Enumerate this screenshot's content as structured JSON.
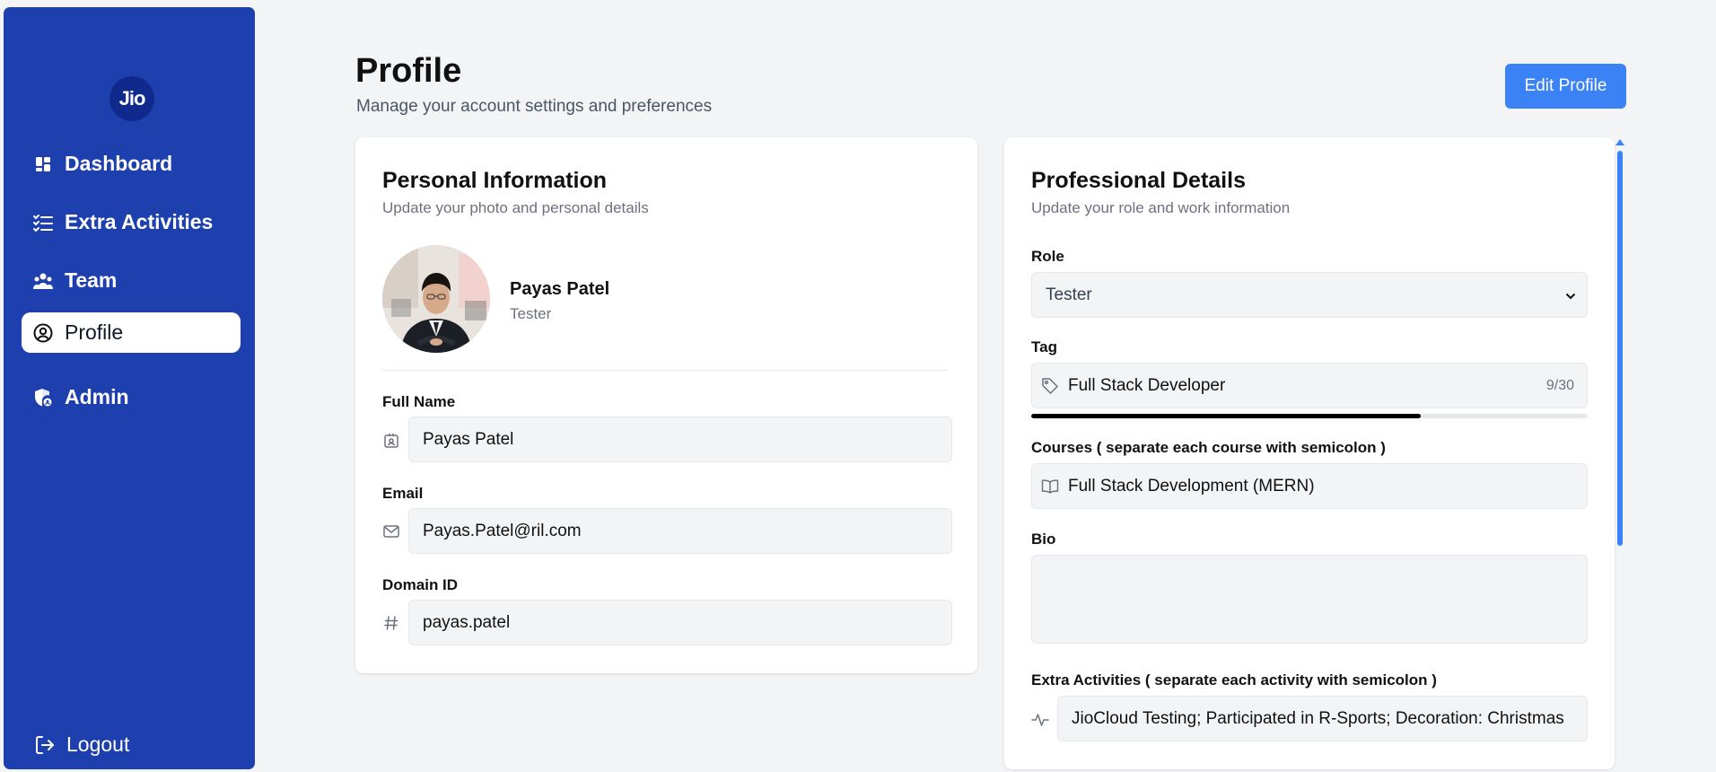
{
  "sidebar": {
    "logo_text": "Jio",
    "items": [
      {
        "label": "Dashboard",
        "icon": "dashboard-icon"
      },
      {
        "label": "Extra Activities",
        "icon": "list-check-icon"
      },
      {
        "label": "Team",
        "icon": "team-icon"
      },
      {
        "label": "Profile",
        "icon": "user-circle-icon",
        "active": true
      },
      {
        "label": "Admin",
        "icon": "shield-user-icon"
      }
    ],
    "logout_label": "Logout"
  },
  "header": {
    "title": "Profile",
    "subtitle": "Manage your account settings and preferences",
    "edit_label": "Edit Profile"
  },
  "personal": {
    "title": "Personal Information",
    "subtitle": "Update your photo and personal details",
    "name": "Payas Patel",
    "role": "Tester",
    "full_name_label": "Full Name",
    "full_name_value": "Payas Patel",
    "email_label": "Email",
    "email_value": "Payas.Patel@ril.com",
    "domain_label": "Domain ID",
    "domain_value": "payas.patel"
  },
  "professional": {
    "title": "Professional Details",
    "subtitle": "Update your role and work information",
    "role_label": "Role",
    "role_value": "Tester",
    "tag_label": "Tag",
    "tag_value": "Full Stack Developer",
    "tag_count": "9/30",
    "tag_progress": 0.7,
    "courses_label": "Courses ( separate each course with semicolon )",
    "courses_value": "Full Stack Development (MERN)",
    "bio_label": "Bio",
    "bio_value": "",
    "activities_label": "Extra Activities ( separate each activity with semicolon )",
    "activities_value": "JioCloud Testing; Participated in R-Sports; Decoration: Christmas"
  },
  "colors": {
    "sidebar": "#1e40af",
    "accent": "#3b82f6",
    "background": "#f3f4f6"
  }
}
